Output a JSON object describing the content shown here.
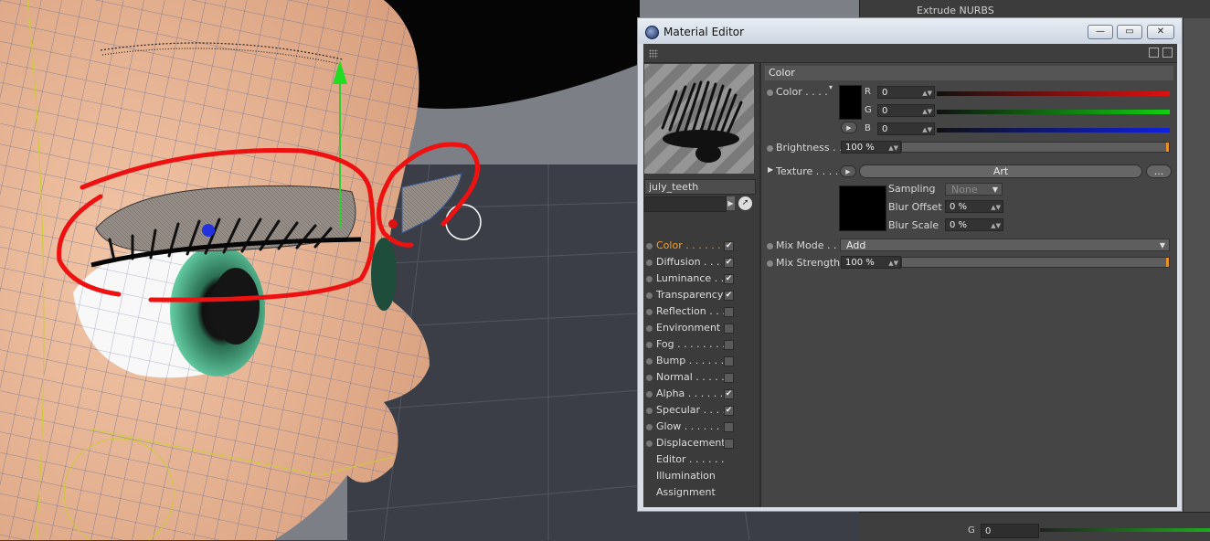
{
  "app": {
    "top_panel_item": "Extrude NURBS",
    "bottom_panel": {
      "label": "G",
      "value": "0"
    }
  },
  "window": {
    "title": "Material Editor",
    "minimize_glyph": "—",
    "maximize_glyph": "▭",
    "close_glyph": "✕"
  },
  "material": {
    "name": "july_teeth"
  },
  "channels": [
    {
      "label": "Color . . . . . .",
      "checked": true,
      "active": true
    },
    {
      "label": "Diffusion . . . .",
      "checked": true
    },
    {
      "label": "Luminance . .",
      "checked": true
    },
    {
      "label": "Transparency",
      "checked": true
    },
    {
      "label": "Reflection . . .",
      "checked": false
    },
    {
      "label": "Environment",
      "checked": false
    },
    {
      "label": "Fog . . . . . . . .",
      "checked": false
    },
    {
      "label": "Bump . . . . . .",
      "checked": false
    },
    {
      "label": "Normal . . . . .",
      "checked": false
    },
    {
      "label": "Alpha . . . . . .",
      "checked": true
    },
    {
      "label": "Specular . . . .",
      "checked": true
    },
    {
      "label": "Glow . . . . . . .",
      "checked": false
    },
    {
      "label": "Displacement",
      "checked": false
    },
    {
      "label": "Editor . . . . . .",
      "noCheckbox": true
    },
    {
      "label": "Illumination",
      "noCheckbox": true
    },
    {
      "label": "Assignment",
      "noCheckbox": true
    }
  ],
  "color_section": {
    "header": "Color",
    "color_label": "Color . . . .",
    "r_label": "R",
    "r_value": "0",
    "g_label": "G",
    "g_value": "0",
    "b_label": "B",
    "b_value": "0",
    "brightness_label": "Brightness . .",
    "brightness_value": "100 %",
    "texture_label": "Texture . . . . .",
    "texture_name": "Art",
    "texture_more": "...",
    "sampling_label": "Sampling",
    "sampling_value": "None",
    "blur_offset_label": "Blur Offset",
    "blur_offset_value": "0 %",
    "blur_scale_label": "Blur Scale",
    "blur_scale_value": "0 %",
    "mix_mode_label": "Mix Mode . .",
    "mix_mode_value": "Add",
    "mix_strength_label": "Mix Strength",
    "mix_strength_value": "100 %"
  },
  "colors": {
    "accent": "#f0a030",
    "annotation_red": "#ee1111",
    "skin": "#e7b796",
    "iris": "#3fbf8a"
  },
  "icons": [
    "cinema4d-icon",
    "grip-icon",
    "lock-icon",
    "new-window-icon",
    "picker-icon",
    "checkbox-icon"
  ]
}
